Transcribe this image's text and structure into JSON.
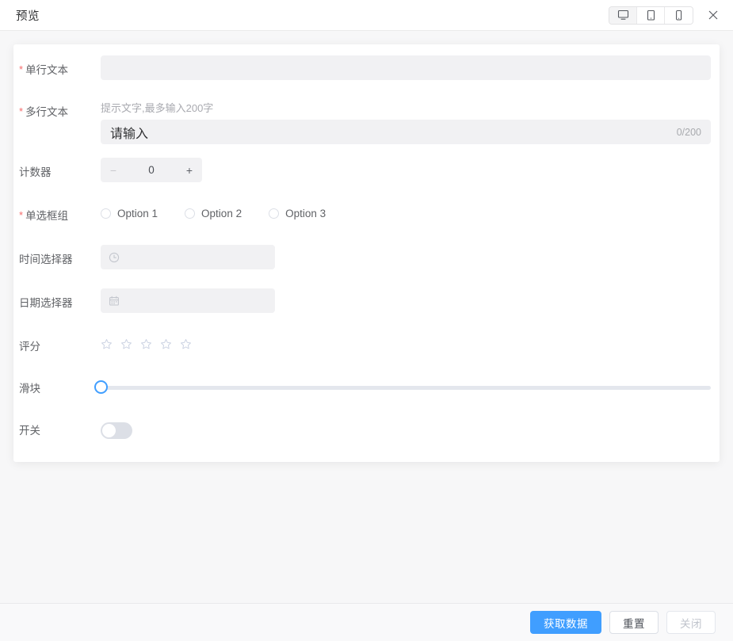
{
  "header": {
    "title": "预览",
    "devices": [
      {
        "name": "desktop-view-button",
        "icon": "monitor-icon",
        "active": true
      },
      {
        "name": "tablet-view-button",
        "icon": "tablet-icon",
        "active": false
      },
      {
        "name": "mobile-view-button",
        "icon": "mobile-icon",
        "active": false
      }
    ],
    "close_icon": "close-icon"
  },
  "form": {
    "fields": {
      "single_line": {
        "label": "单行文本",
        "required": true,
        "value": "",
        "placeholder": ""
      },
      "multi_line": {
        "label": "多行文本",
        "required": true,
        "help": "提示文字,最多输入200字",
        "value": "",
        "placeholder": "请输入",
        "counter": "0/200",
        "maxlength": 200
      },
      "counter": {
        "label": "计数器",
        "required": false,
        "value": "0",
        "decrement": "−",
        "increment": "+"
      },
      "radio_group": {
        "label": "单选框组",
        "required": true,
        "selected": "",
        "options": [
          "Option 1",
          "Option 2",
          "Option 3"
        ]
      },
      "time_picker": {
        "label": "时间选择器",
        "required": false,
        "value": "",
        "icon": "clock-icon"
      },
      "date_picker": {
        "label": "日期选择器",
        "required": false,
        "value": "",
        "icon": "calendar-icon"
      },
      "rating": {
        "label": "评分",
        "required": false,
        "value": 0,
        "max": 5,
        "star_color": "#ccd3e3"
      },
      "slider": {
        "label": "滑块",
        "required": false,
        "value": 0,
        "min": 0,
        "max": 100,
        "handle_color": "#409eff",
        "track_color": "#e4e7ed"
      },
      "switch": {
        "label": "开关",
        "required": false,
        "value": false,
        "off_color": "#dcdfe6"
      }
    }
  },
  "footer": {
    "get_data_label": "获取数据",
    "reset_label": "重置",
    "close_label": "关闭"
  },
  "theme": {
    "accent": "#409eff",
    "required_mark": "#f56c6c",
    "page_bg": "#f7f7f8",
    "field_bg": "#f1f1f3",
    "label_color": "#606266"
  }
}
